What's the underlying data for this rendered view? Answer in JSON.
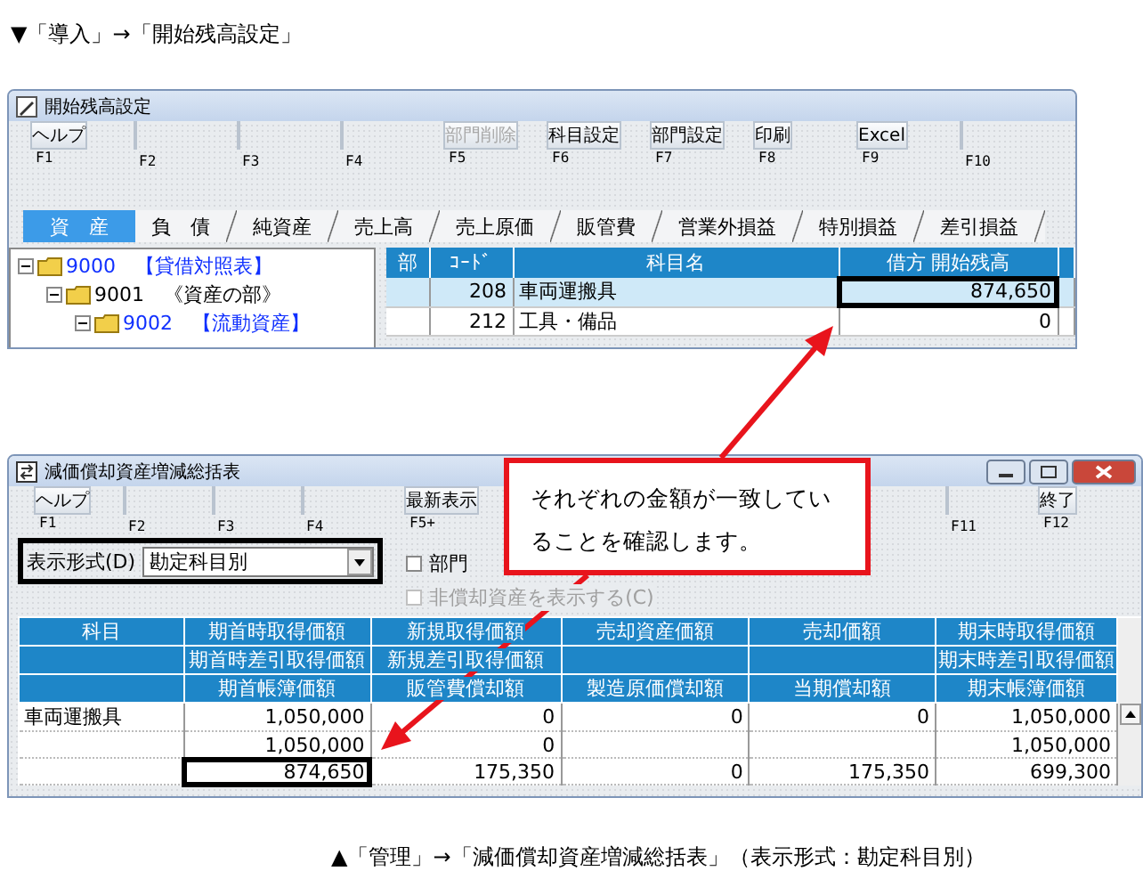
{
  "caption_top": "▼「導入」→「開始残高設定」",
  "window_opening": {
    "title": "開始残高設定",
    "function_keys": [
      {
        "key": "F1",
        "label": "ヘルプ",
        "disabled": false
      },
      {
        "key": "F2"
      },
      {
        "key": "F3"
      },
      {
        "key": "F4"
      },
      {
        "key": "F5",
        "label": "部門削除",
        "disabled": true
      },
      {
        "key": "F6",
        "label": "科目設定",
        "disabled": false
      },
      {
        "key": "F7",
        "label": "部門設定",
        "disabled": false
      },
      {
        "key": "F8",
        "label": "印刷",
        "disabled": false
      },
      {
        "key": "F9",
        "label": "Excel",
        "disabled": false
      },
      {
        "key": "F10"
      }
    ],
    "tabs": [
      {
        "label": "資　産",
        "selected": true
      },
      {
        "label": "負　債",
        "selected": false
      },
      {
        "label": "純資産",
        "selected": false
      },
      {
        "label": "売上高",
        "selected": false
      },
      {
        "label": "売上原価",
        "selected": false
      },
      {
        "label": "販管費",
        "selected": false
      },
      {
        "label": "営業外損益",
        "selected": false
      },
      {
        "label": "特別損益",
        "selected": false
      },
      {
        "label": "差引損益",
        "selected": false
      }
    ],
    "tree": [
      {
        "label": "9000　【貸借対照表】",
        "kind": "heading",
        "expanded": true,
        "children": [
          {
            "label": "9001　《資産の部》",
            "kind": "section",
            "expanded": true,
            "children": [
              {
                "label": "9002　【流動資産】",
                "kind": "heading",
                "expanded": true
              }
            ]
          }
        ]
      }
    ],
    "table": {
      "columns": [
        "部",
        "ｺｰﾄﾞ",
        "科目名",
        "借方 開始残高"
      ],
      "rows": [
        {
          "code": "208",
          "name": "車両運搬具",
          "amount": "874,650",
          "selected": true,
          "amount_boxed": true
        },
        {
          "code": "212",
          "name": "工具・備品",
          "amount": "0",
          "selected": false,
          "amount_boxed": false
        }
      ]
    }
  },
  "window_summary": {
    "title": "減価償却資産増減総括表",
    "function_keys_left": [
      {
        "key": "F1",
        "label": "ヘルプ"
      },
      {
        "key": "F2"
      },
      {
        "key": "F3"
      },
      {
        "key": "F4"
      },
      {
        "key": "F5+",
        "label": "最新表示"
      }
    ],
    "function_keys_right": [
      {
        "key": "F11"
      },
      {
        "key": "F12",
        "label": "終了"
      }
    ],
    "display_format": {
      "label": "表示形式(D)",
      "value": "勘定科目別",
      "boxed": true
    },
    "options": [
      {
        "label": "部門",
        "checked": false,
        "disabled": false
      },
      {
        "label": "非償却資産を表示する(C)",
        "checked": false,
        "disabled": true
      }
    ],
    "table": {
      "header_rows": [
        [
          "科目",
          "期首時取得価額",
          "新規取得価額",
          "売却資産価額",
          "売却価額",
          "期末時取得価額"
        ],
        [
          null,
          "期首時差引取得価額",
          "新規差引取得価額",
          null,
          null,
          "期末時差引取得価額"
        ],
        [
          null,
          "期首帳簿価額",
          "販管費償却額",
          "製造原価償却額",
          "当期償却額",
          "期末帳簿価額"
        ]
      ],
      "rows": [
        {
          "cells": [
            {
              "text": "車両運搬具",
              "boxed": false
            },
            {
              "text": "1,050,000",
              "boxed": false
            },
            {
              "text": "0",
              "boxed": false
            },
            {
              "text": "0",
              "boxed": false
            },
            {
              "text": "0",
              "boxed": false
            },
            {
              "text": "1,050,000",
              "boxed": false
            }
          ]
        },
        {
          "cells": [
            null,
            {
              "text": "1,050,000",
              "boxed": false
            },
            {
              "text": "0",
              "boxed": false
            },
            null,
            null,
            {
              "text": "1,050,000",
              "boxed": false
            }
          ]
        },
        {
          "cells": [
            null,
            {
              "text": "874,650",
              "boxed": true
            },
            {
              "text": "175,350",
              "boxed": false
            },
            {
              "text": "0",
              "boxed": false
            },
            {
              "text": "175,350",
              "boxed": false
            },
            {
              "text": "699,300",
              "boxed": false
            }
          ]
        }
      ]
    }
  },
  "callout": {
    "text": "それぞれの金額が一致していることを確認します。"
  },
  "caption_bottom": "▲「管理」→「減価償却資産増減総括表」（表示形式：勘定科目別）"
}
